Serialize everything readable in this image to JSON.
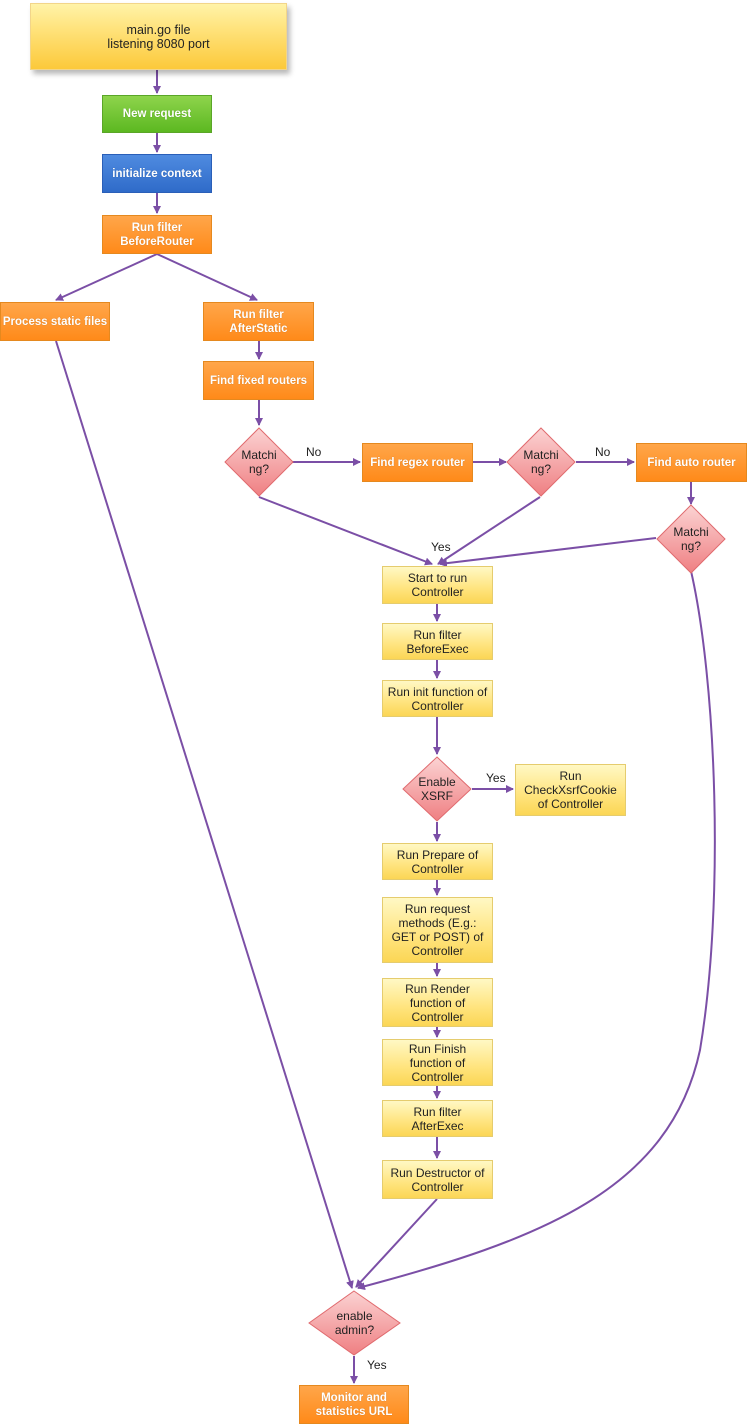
{
  "diagram": {
    "nodes": {
      "main": "main.go file\nlistening 8080 port",
      "new_request": "New request",
      "init_context": "initialize context",
      "before_router": "Run filter\nBeforeRouter",
      "static_files": "Process static files",
      "after_static": "Run filter\nAfterStatic",
      "fixed_routers": "Find fixed routers",
      "match1": "Matchi\nng?",
      "regex_router": "Find regex router",
      "match2": "Matchi\nng?",
      "auto_router": "Find auto router",
      "match3": "Matchi\nng?",
      "start_controller": "Start to run\nController",
      "before_exec": "Run filter\nBeforeExec",
      "init_function": "Run init function of\nController",
      "enable_xsrf": "Enable\nXSRF",
      "check_xsrf": "Run\nCheckXsrfCookie\nof Controller",
      "prepare": "Run Prepare of\nController",
      "request_methods": "Run request\nmethods (E.g.:\nGET or POST) of\nController",
      "render": "Run Render\nfunction of\nController",
      "finish": "Run Finish\nfunction of\nController",
      "after_exec": "Run filter\nAfterExec",
      "destructor": "Run Destructor of\nController",
      "enable_admin": "enable\nadmin?",
      "monitor": "Monitor and\nstatistics URL"
    },
    "edge_labels": {
      "no1": "No",
      "no2": "No",
      "yes_match": "Yes",
      "yes_xsrf": "Yes",
      "yes_admin": "Yes"
    },
    "colors": {
      "edge": "#7b4fa6",
      "diamond_top": "#fbd3d3",
      "diamond_bottom": "#ef7f82",
      "diamond_stroke": "#e06a6e"
    }
  }
}
